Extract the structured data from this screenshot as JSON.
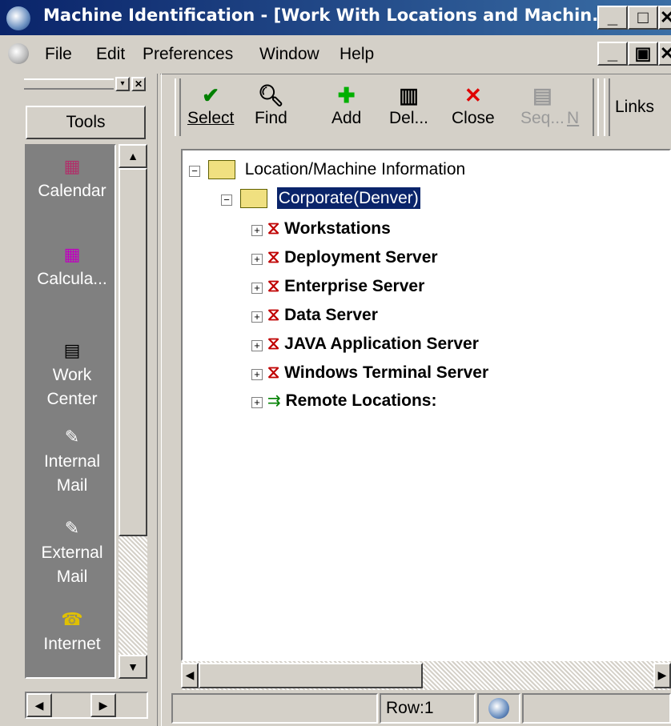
{
  "window": {
    "title": "Machine Identification - [Work With Locations and Machin...",
    "minimize": "_",
    "maximize": "□",
    "close": "✕",
    "child_minimize": "_",
    "child_restore": "▣",
    "child_close": "✕"
  },
  "menu": {
    "file": "File",
    "edit": "Edit",
    "preferences": "Preferences",
    "window": "Window",
    "help": "Help"
  },
  "tools": {
    "header": "Tools",
    "items": [
      {
        "label": "Calendar",
        "icon": "calendar-icon"
      },
      {
        "label": "Calcula...",
        "icon": "calculator-icon"
      },
      {
        "label": "Work Center",
        "icon": "work-center-icon"
      },
      {
        "label": "Internal Mail",
        "icon": "internal-mail-icon"
      },
      {
        "label": "External Mail",
        "icon": "external-mail-icon"
      },
      {
        "label": "Internet",
        "icon": "internet-icon"
      }
    ]
  },
  "toolbar": {
    "select": "Select",
    "find": "Find",
    "add": "Add",
    "delete": "Del...",
    "close": "Close",
    "seq": "Seq...",
    "n": "N",
    "links": "Links"
  },
  "tree": {
    "root": "Location/Machine Information",
    "location": "Corporate(Denver)",
    "children": [
      "Workstations",
      "Deployment Server",
      "Enterprise Server",
      "Data Server",
      "JAVA Application Server",
      "Windows Terminal Server",
      "Remote Locations:"
    ]
  },
  "status": {
    "row": "Row:1"
  },
  "colors": {
    "title_bar": "#0a246a",
    "selection": "#0a246a",
    "tools_bg": "#808080",
    "window_bg": "#d4d0c8"
  }
}
